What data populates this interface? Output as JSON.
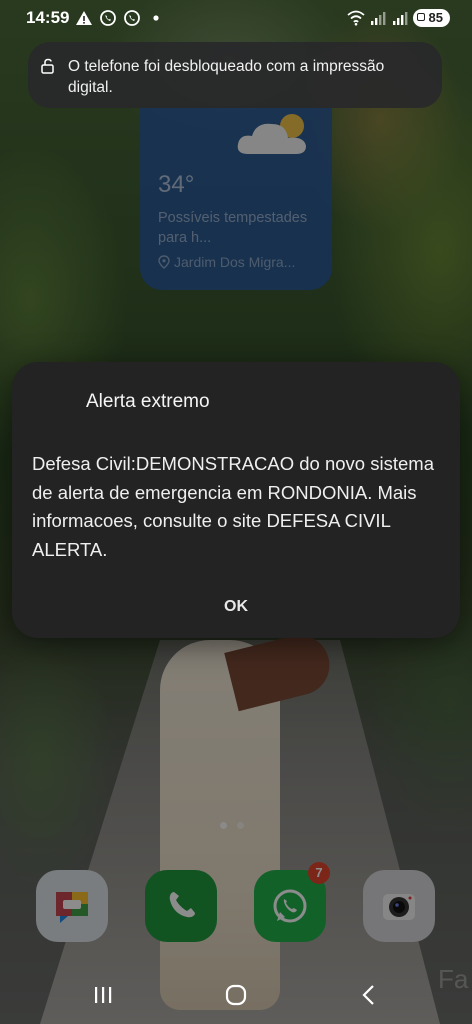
{
  "status_bar": {
    "time": "14:59",
    "battery": "85"
  },
  "toast": {
    "text": "O telefone foi desbloqueado com a impressão digital."
  },
  "weather": {
    "temperature": "34°",
    "description": "Possíveis tempestades para h...",
    "location": "Jardim Dos Migra..."
  },
  "alert": {
    "title": "Alerta extremo",
    "message": "Defesa Civil:DEMONSTRACAO do novo sistema de alerta de emergencia em RONDONIA. Mais informacoes, consulte o site DEFESA CIVIL ALERTA.",
    "ok_label": "OK"
  },
  "dock": {
    "whatsapp_badge": "7",
    "partial_label": "Fa"
  },
  "colors": {
    "dialog_bg": "#232323",
    "weather_bg": "#285aaa",
    "badge": "#e0452c",
    "whatsapp": "#22b14c",
    "phone": "#1f9a3e"
  },
  "icons": {
    "status_left": [
      "alert-triangle-icon",
      "whatsapp-icon",
      "whatsapp-icon",
      "dot-icon"
    ],
    "status_right": [
      "wifi-icon",
      "signal-icon",
      "signal-icon",
      "battery-icon"
    ],
    "toast": "unlock-icon",
    "weather": "partly-cloudy-icon",
    "location": "location-pin-icon",
    "dock": [
      "messages-icon",
      "phone-icon",
      "whatsapp-icon",
      "camera-icon"
    ],
    "nav": [
      "recents-icon",
      "home-icon",
      "back-icon"
    ]
  }
}
